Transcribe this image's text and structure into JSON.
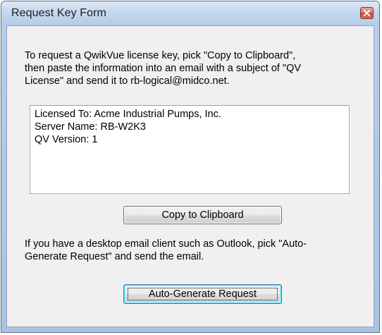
{
  "window": {
    "title": "Request Key Form"
  },
  "instructions": {
    "lines": [
      "To request a QwikVue license key, pick \"Copy to Clipboard\",",
      "then paste the information into an email with a subject of \"QV",
      "License\" and send it to rb-logical@midco.net."
    ]
  },
  "info_box": {
    "lines": [
      "Licensed To: Acme Industrial Pumps, Inc.",
      "Server Name: RB-W2K3",
      "QV Version: 1"
    ]
  },
  "buttons": {
    "copy_label": "Copy to Clipboard",
    "auto_label": "Auto-Generate Request"
  },
  "second_instructions": {
    "lines": [
      "If you have a desktop email client such as Outlook, pick \"Auto-",
      "Generate Request\" and send the email."
    ]
  },
  "colors": {
    "title_bar": "#c5d8ef",
    "close_button": "#c44d35",
    "client_background": "#f0f0f0",
    "default_button_border": "#3c7fb1"
  },
  "icons": {
    "close": "close-icon"
  }
}
